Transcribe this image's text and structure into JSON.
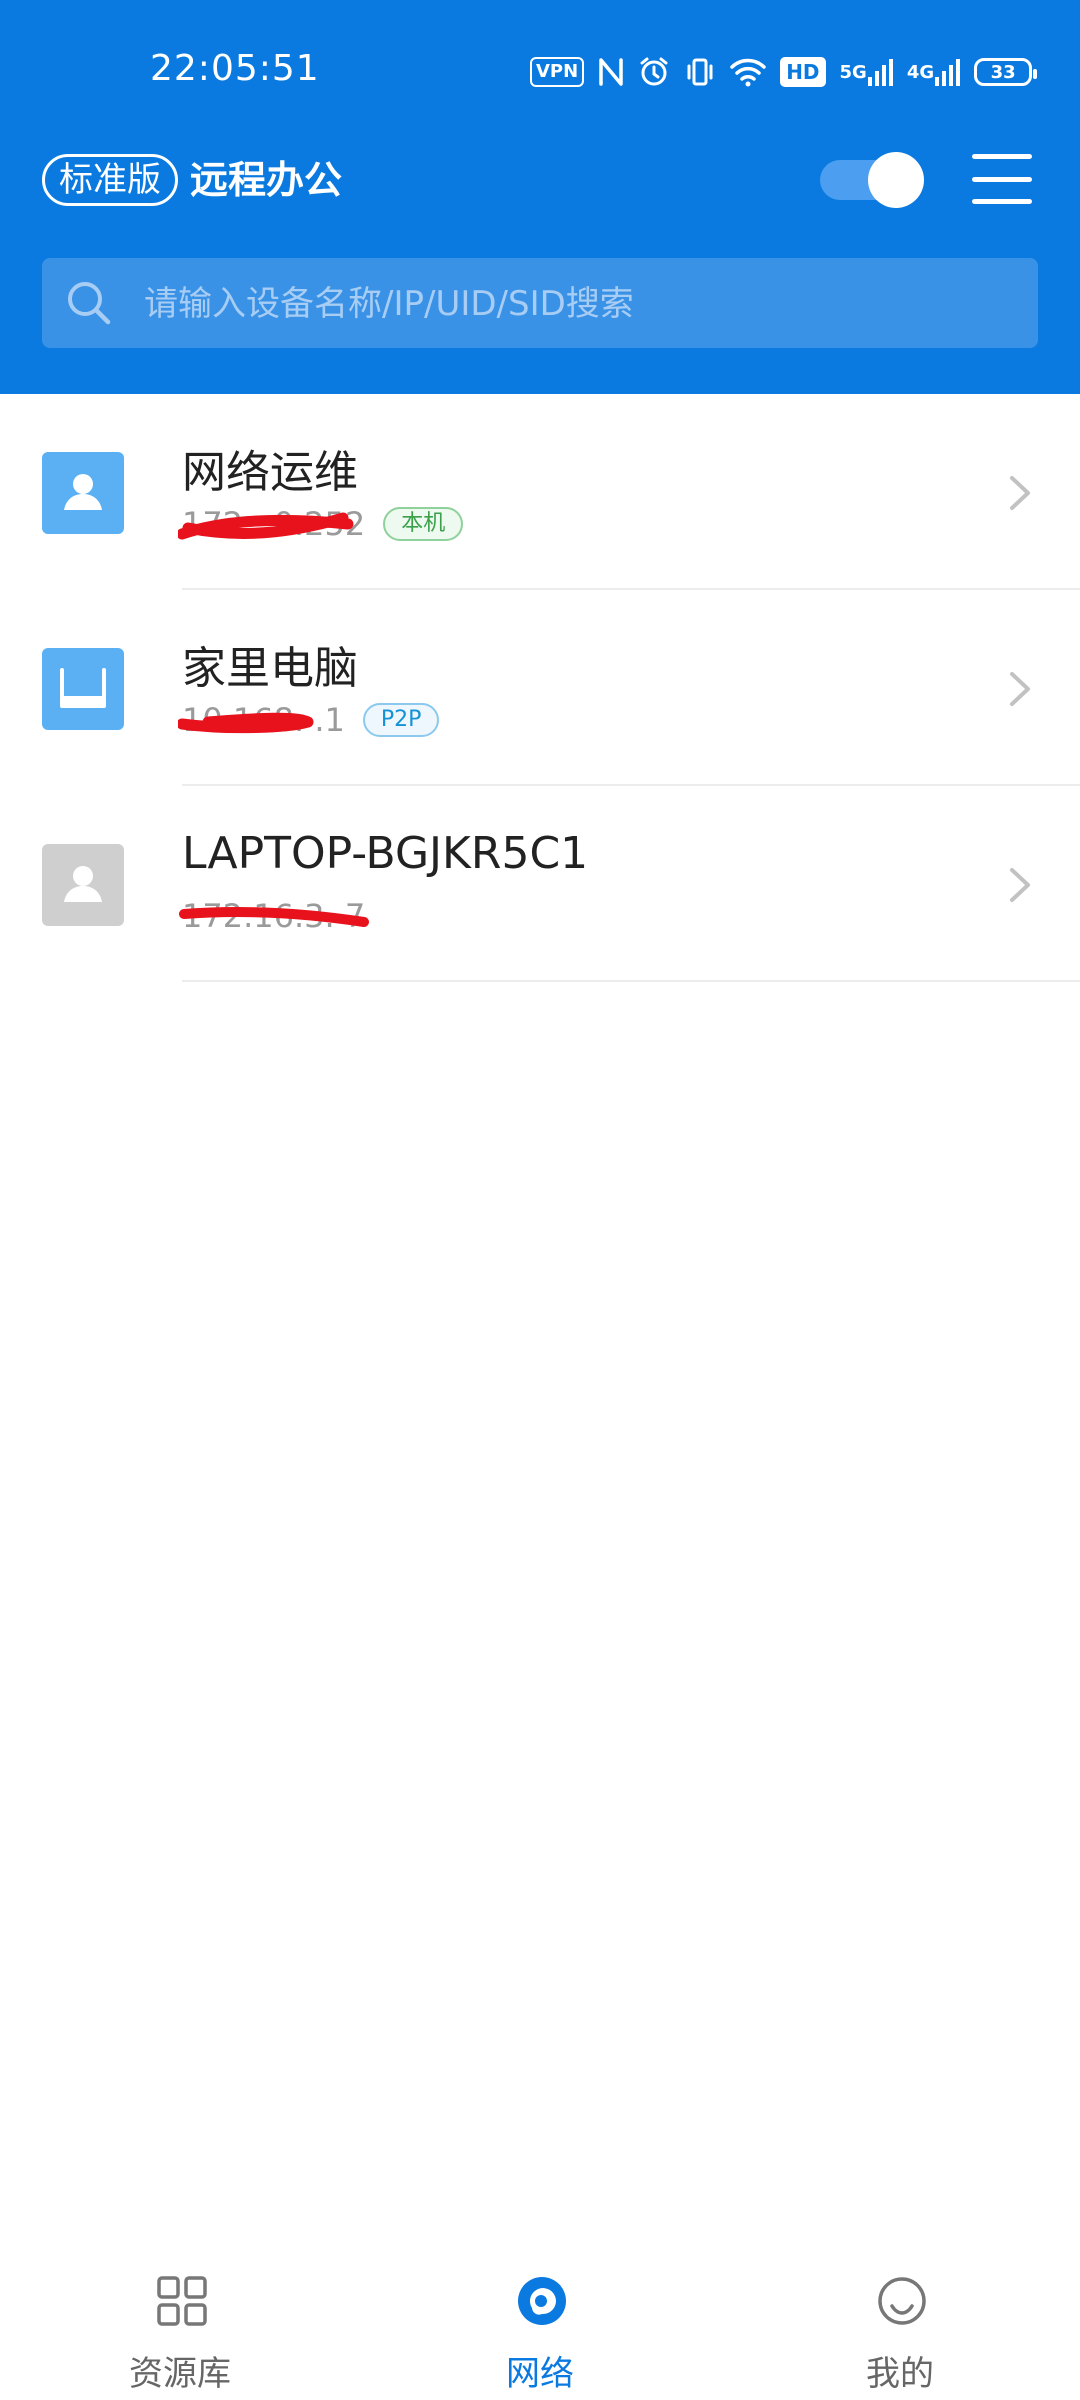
{
  "status_bar": {
    "time": "22:05:51",
    "vpn": "VPN",
    "hd": "HD",
    "net5g": "5G",
    "net4g": "4G",
    "battery": "33"
  },
  "header": {
    "edition": "标准版",
    "title": "远程办公",
    "toggle_on": true,
    "accent": "#0a7ae0"
  },
  "search": {
    "placeholder": "请输入设备名称/IP/UID/SID搜索"
  },
  "devices": [
    {
      "name": "网络运维",
      "ip": "172.  .0.252",
      "tag": "本机",
      "icon": "user-avatar-icon"
    },
    {
      "name": "家里电脑",
      "ip": "10.168.  .1",
      "tag": "P2P",
      "icon": "router-icon"
    },
    {
      "name": "LAPTOP-BGJKR5C1",
      "ip": "172.16.3.  7",
      "tag": "",
      "icon": "user-avatar-icon"
    }
  ],
  "tabs": [
    {
      "label": "资源库",
      "icon": "grid-icon"
    },
    {
      "label": "网络",
      "icon": "network-icon",
      "active": true
    },
    {
      "label": "我的",
      "icon": "profile-icon"
    }
  ]
}
